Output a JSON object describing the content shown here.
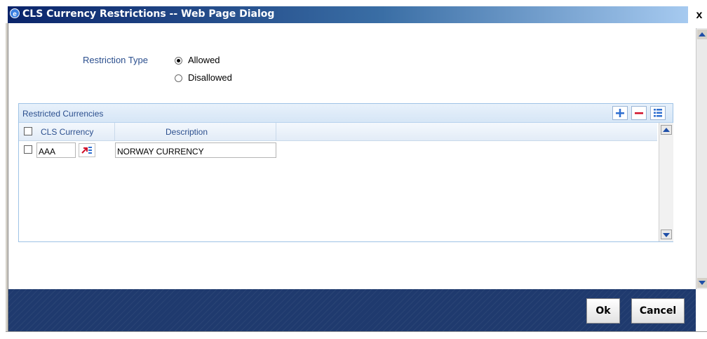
{
  "window": {
    "title": "CLS Currency Restrictions -- Web Page Dialog",
    "close_glyph": "x"
  },
  "form": {
    "restriction_type_label": "Restriction Type",
    "options": [
      {
        "label": "Allowed",
        "selected": true
      },
      {
        "label": "Disallowed",
        "selected": false
      }
    ]
  },
  "panel": {
    "title": "Restricted Currencies",
    "toolbar": {
      "add_icon": "plus-icon",
      "remove_icon": "minus-icon",
      "view_icon": "list-icon"
    },
    "columns": [
      "CLS Currency",
      "Description"
    ],
    "rows": [
      {
        "checked": false,
        "currency": "AAA",
        "description": "NORWAY CURRENCY"
      }
    ]
  },
  "footer": {
    "ok_label": "Ok",
    "cancel_label": "Cancel"
  },
  "colors": {
    "title_bar": "#0a246a",
    "label_text": "#2b4f8e",
    "footer_bg": "#1f3a6e",
    "icon_blue": "#2f6fd0",
    "icon_red": "#d0102a"
  }
}
